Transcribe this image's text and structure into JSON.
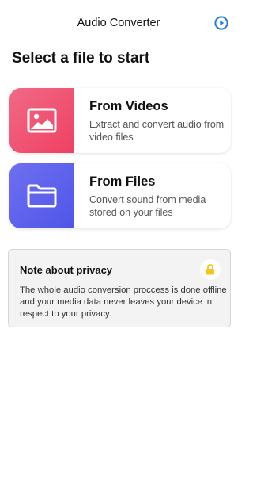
{
  "header": {
    "title": "Audio Converter",
    "action_icon": "play-circle-icon",
    "accent": "#1e7be0"
  },
  "main": {
    "heading": "Select a file to start",
    "cards": [
      {
        "label": "From Videos",
        "description": "Extract and convert audio from video files",
        "icon": "image-icon",
        "color": "#f04a6a"
      },
      {
        "label": "From Files",
        "description": "Convert sound from media stored on your files",
        "icon": "folder-icon",
        "color": "#5a5fea"
      }
    ]
  },
  "privacy": {
    "title": "Note about privacy",
    "text": "The whole audio conversion proccess is done offline and your media data never leaves your device in respect to your privacy.",
    "icon": "lock-icon",
    "icon_color": "#f5c518"
  }
}
